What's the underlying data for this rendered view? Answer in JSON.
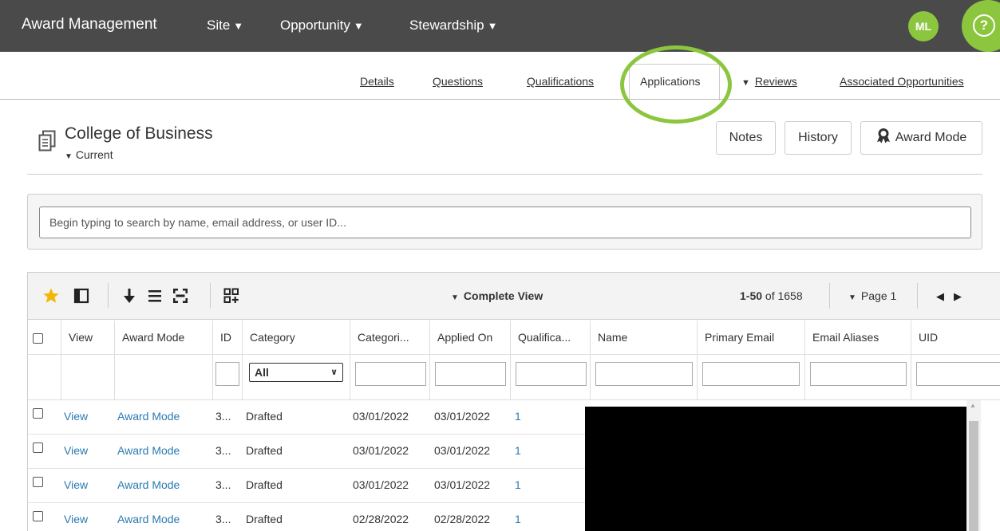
{
  "topbar": {
    "brand": "Award Management",
    "nav": [
      {
        "label": "Site"
      },
      {
        "label": "Opportunity"
      },
      {
        "label": "Stewardship"
      }
    ],
    "user_initials": "ML",
    "help_glyph": "?"
  },
  "subnav": {
    "tabs": [
      {
        "label": "Details"
      },
      {
        "label": "Questions"
      },
      {
        "label": "Qualifications"
      },
      {
        "label": "Applications"
      },
      {
        "label": "Reviews"
      },
      {
        "label": "Associated Opportunities"
      }
    ],
    "active": "Applications"
  },
  "header": {
    "title": "College of Business",
    "subtitle": "Current",
    "buttons": {
      "notes": "Notes",
      "history": "History",
      "award_mode": "Award Mode"
    }
  },
  "search": {
    "placeholder": "Begin typing to search by name, email address, or user ID..."
  },
  "grid": {
    "view": "Complete View",
    "range_start_end": "1-50",
    "range_of": "of 1658",
    "page": "Page 1",
    "columns": [
      "View",
      "Award Mode",
      "ID",
      "Category",
      "Categori...",
      "Applied On",
      "Qualifica...",
      "Name",
      "Primary Email",
      "Email Aliases",
      "UID"
    ],
    "category_filter": "All",
    "rows": [
      {
        "view": "View",
        "award_mode": "Award Mode",
        "id": "3...",
        "category": "Drafted",
        "categorized": "03/01/2022",
        "applied_on": "03/01/2022",
        "qualifications": "1"
      },
      {
        "view": "View",
        "award_mode": "Award Mode",
        "id": "3...",
        "category": "Drafted",
        "categorized": "03/01/2022",
        "applied_on": "03/01/2022",
        "qualifications": "1"
      },
      {
        "view": "View",
        "award_mode": "Award Mode",
        "id": "3...",
        "category": "Drafted",
        "categorized": "03/01/2022",
        "applied_on": "03/01/2022",
        "qualifications": "1"
      },
      {
        "view": "View",
        "award_mode": "Award Mode",
        "id": "3...",
        "category": "Drafted",
        "categorized": "02/28/2022",
        "applied_on": "02/28/2022",
        "qualifications": "1"
      }
    ]
  },
  "colors": {
    "topbar": "#4a4a4a",
    "accent_green": "#8cc63f",
    "link": "#2a7ab0",
    "star": "#f2b705"
  }
}
